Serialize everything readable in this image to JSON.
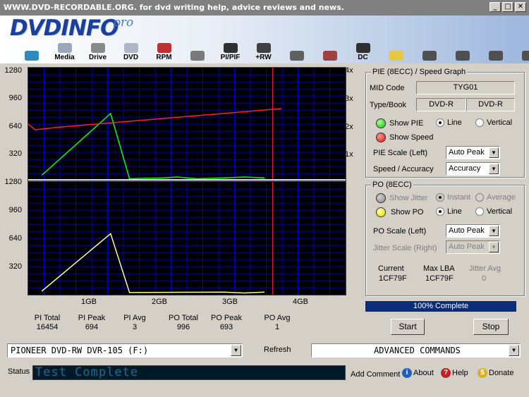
{
  "window": {
    "title": "WWW.DVD-RECORDABLE.ORG.  for dvd writing help, advice reviews and news.",
    "min": "_",
    "max": "□",
    "close": "✕"
  },
  "brand": {
    "logo": "DVDINFO",
    "pro": "pro"
  },
  "toolbar": [
    {
      "name": "monitor",
      "label": "",
      "icon": "monitor-icon",
      "color": "#2e8bc0"
    },
    {
      "name": "media",
      "label": "Media",
      "icon": "media-icon",
      "color": "#9aa7bb"
    },
    {
      "name": "drive",
      "label": "Drive",
      "icon": "drive-icon",
      "color": "#8a8a8a"
    },
    {
      "name": "dvd",
      "label": "DVD",
      "icon": "dvd-icon",
      "color": "#b0b8c8"
    },
    {
      "name": "rpm",
      "label": "RPM",
      "icon": "rpm-icon",
      "color": "#c03030"
    },
    {
      "name": "scan",
      "label": "",
      "icon": "magnifier-icon",
      "color": "#7a7a7a"
    },
    {
      "name": "pipif",
      "label": "PI/PIF",
      "icon": "pipif-icon",
      "color": "#303030"
    },
    {
      "name": "rw",
      "label": "+RW",
      "icon": "rw-icon",
      "color": "#404040"
    },
    {
      "name": "erase",
      "label": "",
      "icon": "eraser-icon",
      "color": "#606060"
    },
    {
      "name": "chart",
      "label": "",
      "icon": "wave-chart-icon",
      "color": "#a04040"
    },
    {
      "name": "dc",
      "label": "DC",
      "icon": "dc-icon",
      "color": "#303030"
    },
    {
      "name": "notes",
      "label": "",
      "icon": "clipboard-icon",
      "color": "#e8c840"
    },
    {
      "name": "camera",
      "label": "",
      "icon": "camera-icon",
      "color": "#505050"
    },
    {
      "name": "edit",
      "label": "",
      "icon": "edit-icon",
      "color": "#505050"
    },
    {
      "name": "play",
      "label": "",
      "icon": "play-pause-icon",
      "color": "#505050"
    },
    {
      "name": "stop",
      "label": "",
      "icon": "stop-icon",
      "color": "#505050"
    }
  ],
  "graph": {
    "pie_yticks": [
      "1280",
      "960",
      "640",
      "320"
    ],
    "speed_ticks": [
      "4x",
      "3x",
      "2x",
      "1x"
    ],
    "po_yticks": [
      "1280",
      "960",
      "640",
      "320"
    ],
    "xticks": [
      "1GB",
      "2GB",
      "3GB",
      "4GB"
    ]
  },
  "chart_data": [
    {
      "type": "line",
      "title": "PIE (8ECC) / Speed Graph",
      "x_unit": "GB",
      "xlim": [
        0,
        4.7
      ],
      "ylim": [
        0,
        1280
      ],
      "y2lim": [
        0,
        4
      ],
      "series": [
        {
          "name": "PIE",
          "color": "#00ff00",
          "points": [
            [
              0.2,
              60
            ],
            [
              1.22,
              760
            ],
            [
              1.5,
              20
            ],
            [
              2.0,
              30
            ],
            [
              2.2,
              40
            ],
            [
              2.5,
              20
            ],
            [
              2.9,
              30
            ],
            [
              3.2,
              40
            ],
            [
              3.5,
              30
            ]
          ]
        },
        {
          "name": "Speed",
          "color": "#ff2020",
          "axis": "right",
          "points": [
            [
              0,
              2.0
            ],
            [
              0.1,
              1.8
            ],
            [
              0.5,
              1.9
            ],
            [
              1.0,
              2.0
            ],
            [
              1.5,
              2.1
            ],
            [
              2.0,
              2.2
            ],
            [
              2.5,
              2.3
            ],
            [
              3.0,
              2.4
            ],
            [
              3.5,
              2.5
            ],
            [
              3.75,
              2.55
            ]
          ]
        }
      ]
    },
    {
      "type": "line",
      "title": "PO (8ECC)",
      "x_unit": "GB",
      "xlim": [
        0,
        4.7
      ],
      "ylim": [
        0,
        1280
      ],
      "series": [
        {
          "name": "PO",
          "color": "#ffff80",
          "points": [
            [
              0.2,
              40
            ],
            [
              1.22,
              693
            ],
            [
              1.5,
              25
            ],
            [
              2.9,
              30
            ],
            [
              3.2,
              20
            ],
            [
              3.5,
              30
            ]
          ]
        }
      ]
    }
  ],
  "stats": [
    {
      "label": "PI Total",
      "value": "16454"
    },
    {
      "label": "PI Peak",
      "value": "694"
    },
    {
      "label": "PI Avg",
      "value": "3"
    },
    {
      "label": "PO Total",
      "value": "996"
    },
    {
      "label": "PO Peak",
      "value": "693"
    },
    {
      "label": "PO Avg",
      "value": "1"
    }
  ],
  "pie_panel": {
    "title": "PIE (8ECC) / Speed Graph",
    "mid_label": "MID Code",
    "mid_value": "TYG01",
    "type_label": "Type/Book",
    "type_value": "DVD-R",
    "book_value": "DVD-R",
    "show_pie": "Show PIE",
    "show_speed": "Show Speed",
    "line": "Line",
    "vertical": "Vertical",
    "scale_label": "PIE Scale (Left)",
    "scale_value": "Auto Peak",
    "accuracy_label": "Speed / Accuracy",
    "accuracy_value": "Accuracy"
  },
  "po_panel": {
    "title": "PO (8ECC)",
    "show_jitter": "Show Jitter",
    "instant": "Instant",
    "average": "Average",
    "show_po": "Show PO",
    "line": "Line",
    "vertical": "Vertical",
    "scale_label": "PO Scale (Left)",
    "scale_value": "Auto Peak",
    "jitter_scale_label": "Jitter Scale (Right)",
    "jitter_scale_value": "Auto Peak",
    "current_label": "Current",
    "current_value": "1CF79F",
    "maxlba_label": "Max LBA",
    "maxlba_value": "1CF79F",
    "jitter_avg_label": "Jitter Avg",
    "jitter_avg_value": "0"
  },
  "progress": {
    "text": "100% Complete",
    "fraction": 1.0
  },
  "buttons": {
    "start": "Start",
    "stop": "Stop",
    "refresh": "Refresh",
    "add_comment": "Add Comment",
    "about": "About",
    "help": "Help",
    "donate": "Donate"
  },
  "drive_select": "PIONEER DVD-RW  DVR-105  (F:)",
  "commands_select": "ADVANCED COMMANDS",
  "status": {
    "label": "Status",
    "text": "Test Complete"
  },
  "colors": {
    "grid": "#0000c0",
    "plot_bg": "#000000",
    "progress": "#0b2c78"
  }
}
